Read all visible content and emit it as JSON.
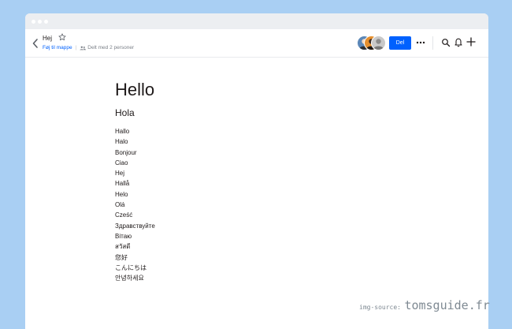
{
  "document": {
    "title": "Hej",
    "folder_link": "Føj til mappe",
    "divider": "|",
    "shared_with": "Delt med 2 personer"
  },
  "toolbar": {
    "share_label": "Del",
    "icons": [
      "chevron-left-icon",
      "star-icon",
      "people-icon",
      "more-icon",
      "search-icon",
      "bell-icon",
      "plus-icon"
    ]
  },
  "content": {
    "heading": "Hello",
    "subheading": "Hola",
    "greetings": [
      "Hallo",
      "Halo",
      "Bonjour",
      "Ciao",
      "Hej",
      "Hallå",
      "Helo",
      "Olá",
      "Cześć",
      "Здравствуйте",
      "Вітаю",
      "สวัสดี",
      "您好",
      "こんにちは",
      "안녕하세요"
    ]
  },
  "watermark": {
    "label": "img-source:",
    "site": "tomsguide.fr"
  },
  "colors": {
    "background": "#a9cff3",
    "accent": "#0061fe",
    "text": "#1e1919"
  }
}
